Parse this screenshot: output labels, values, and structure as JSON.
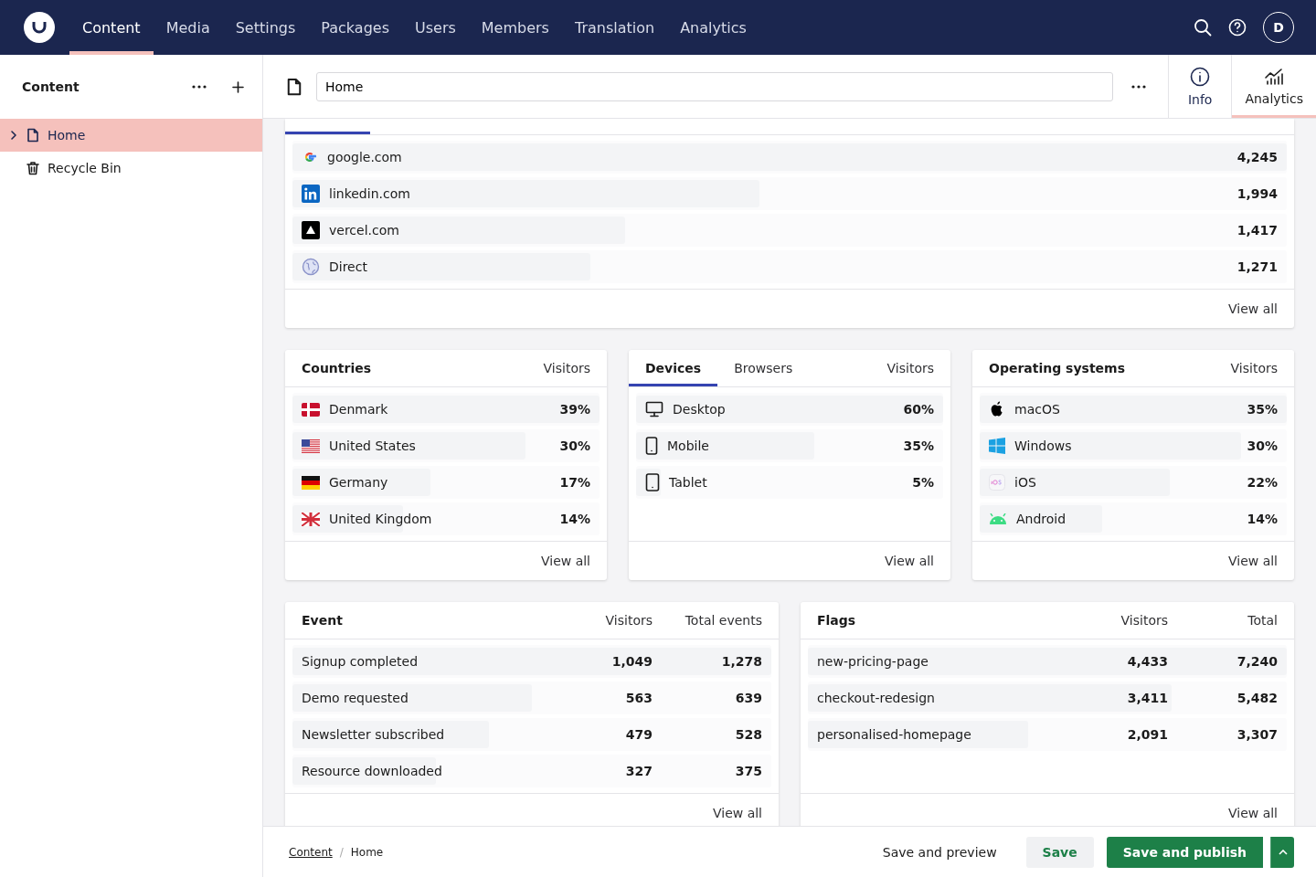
{
  "nav": {
    "items": [
      {
        "label": "Content",
        "selected": true
      },
      {
        "label": "Media",
        "selected": false
      },
      {
        "label": "Settings",
        "selected": false
      },
      {
        "label": "Packages",
        "selected": false
      },
      {
        "label": "Users",
        "selected": false
      },
      {
        "label": "Members",
        "selected": false
      },
      {
        "label": "Translation",
        "selected": false
      },
      {
        "label": "Analytics",
        "selected": false
      }
    ],
    "avatar": "D"
  },
  "sidebar": {
    "title": "Content",
    "items": [
      {
        "label": "Home",
        "selected": true,
        "expanded": false,
        "kind": "page"
      },
      {
        "label": "Recycle Bin",
        "selected": false,
        "kind": "bin"
      }
    ]
  },
  "editor": {
    "name": "Home",
    "views": [
      {
        "label": "Info",
        "selected": false
      },
      {
        "label": "Analytics",
        "selected": true
      }
    ]
  },
  "referrers": {
    "rows": [
      {
        "cells": [
          "google.com",
          "4,245"
        ],
        "level": 1
      },
      {
        "cells": [
          "linkedin.com",
          "1,994"
        ],
        "level": 0.47
      },
      {
        "cells": [
          "vercel.com",
          "1,417"
        ],
        "level": 0.335
      },
      {
        "cells": [
          "Direct",
          "1,271"
        ],
        "level": 0.3
      }
    ],
    "view_all": "View all"
  },
  "countries": {
    "columns": [
      "Countries",
      "Visitors"
    ],
    "rows": [
      {
        "cells": [
          "Denmark",
          "39%"
        ],
        "level": 1
      },
      {
        "cells": [
          "United States",
          "30%"
        ],
        "level": 0.76
      },
      {
        "cells": [
          "Germany",
          "17%"
        ],
        "level": 0.45
      },
      {
        "cells": [
          "United Kingdom",
          "14%"
        ],
        "level": 0.36
      }
    ],
    "view_all": "View all"
  },
  "devices": {
    "tabs": [
      {
        "label": "Devices",
        "selected": true
      },
      {
        "label": "Browsers",
        "selected": false
      }
    ],
    "value_header": "Visitors",
    "rows": [
      {
        "cells": [
          "Desktop",
          "60%"
        ],
        "level": 1
      },
      {
        "cells": [
          "Mobile",
          "35%"
        ],
        "level": 0.58
      },
      {
        "cells": [
          "Tablet",
          "5%"
        ],
        "level": 0.08
      }
    ],
    "view_all": "View all"
  },
  "operating_systems": {
    "columns": [
      "Operating systems",
      "Visitors"
    ],
    "rows": [
      {
        "cells": [
          "macOS",
          "35%"
        ],
        "level": 1
      },
      {
        "cells": [
          "Windows",
          "30%"
        ],
        "level": 0.85
      },
      {
        "cells": [
          "iOS",
          "22%"
        ],
        "level": 0.62
      },
      {
        "cells": [
          "Android",
          "14%"
        ],
        "level": 0.4
      }
    ],
    "view_all": "View all"
  },
  "events": {
    "columns": [
      "Event",
      "Visitors",
      "Total events"
    ],
    "rows": [
      {
        "cells": [
          "Signup completed",
          "1,049",
          "1,278"
        ],
        "level": 1
      },
      {
        "cells": [
          "Demo requested",
          "563",
          "639"
        ],
        "level": 0.5
      },
      {
        "cells": [
          "Newsletter subscribed",
          "479",
          "528"
        ],
        "level": 0.41
      },
      {
        "cells": [
          "Resource downloaded",
          "327",
          "375"
        ],
        "level": 0.3
      }
    ],
    "view_all": "View all"
  },
  "flags": {
    "columns": [
      "Flags",
      "Visitors",
      "Total"
    ],
    "rows": [
      {
        "cells": [
          "new-pricing-page",
          "4,433",
          "7,240"
        ],
        "level": 1
      },
      {
        "cells": [
          "checkout-redesign",
          "3,411",
          "5,482"
        ],
        "level": 0.76
      },
      {
        "cells": [
          "personalised-homepage",
          "2,091",
          "3,307"
        ],
        "level": 0.46
      }
    ],
    "view_all": "View all"
  },
  "footer": {
    "breadcrumbs": [
      "Content",
      "Home"
    ],
    "separator": "/",
    "buttons": [
      {
        "label": "Save and preview",
        "kind": "plain"
      },
      {
        "label": "Save",
        "kind": "soft"
      },
      {
        "label": "Save and publish",
        "kind": "primary"
      }
    ]
  }
}
